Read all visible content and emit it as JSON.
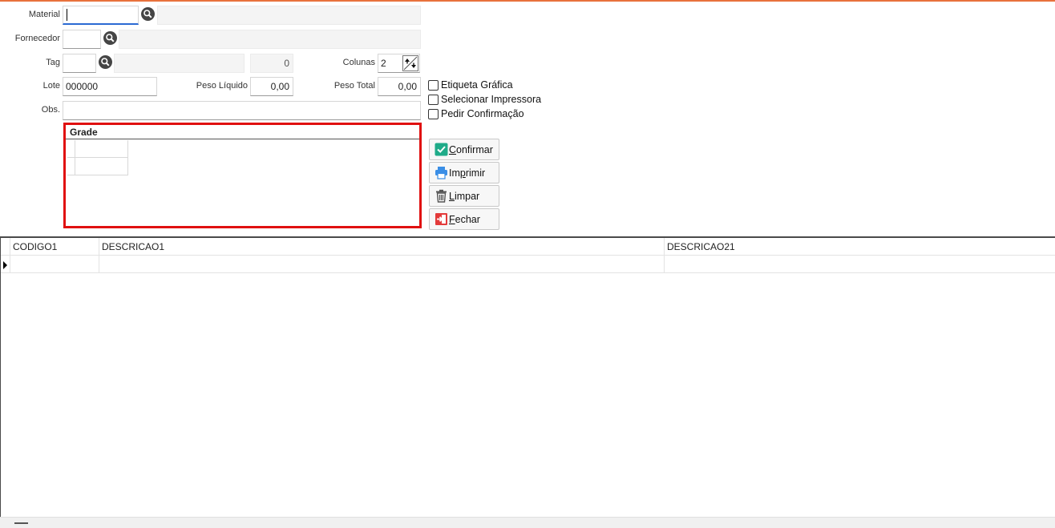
{
  "form": {
    "material_label": "Material",
    "material_value": "",
    "material_desc": "",
    "fornecedor_label": "Fornecedor",
    "fornecedor_value": "",
    "fornecedor_desc": "",
    "tag_label": "Tag",
    "tag_value": "",
    "tag_desc": "",
    "tag_count": "0",
    "colunas_label": "Colunas",
    "colunas_value": "2",
    "lote_label": "Lote",
    "lote_value": "000000",
    "peso_liquido_label": "Peso Líquido",
    "peso_liquido_value": "0,00",
    "peso_total_label": "Peso Total",
    "peso_total_value": "0,00",
    "obs_label": "Obs.",
    "obs_value": ""
  },
  "options": [
    {
      "label": "Etiqueta Gráfica",
      "checked": false
    },
    {
      "label": "Selecionar Impressora",
      "checked": false
    },
    {
      "label": "Pedir Confirmação",
      "checked": false
    }
  ],
  "grade": {
    "title": "Grade"
  },
  "buttons": {
    "confirmar": {
      "accel": "C",
      "rest": "onfirmar",
      "icon": "check-icon",
      "color": "#1fab89"
    },
    "imprimir": {
      "pre": "Im",
      "accel": "p",
      "rest": "rimir",
      "icon": "printer-icon",
      "color": "#3a8ee6"
    },
    "limpar": {
      "accel": "L",
      "rest": "impar",
      "icon": "trash-icon",
      "color": "#555555"
    },
    "fechar": {
      "accel": "F",
      "rest": "echar",
      "icon": "exit-icon",
      "color": "#e33a3a"
    }
  },
  "table": {
    "columns": [
      "CODIGO1",
      "DESCRICAO1",
      "DESCRICAO21"
    ],
    "rows": [
      [
        "",
        "",
        ""
      ]
    ]
  },
  "colors": {
    "accent": "#e8713c",
    "highlight": "#e01010"
  }
}
